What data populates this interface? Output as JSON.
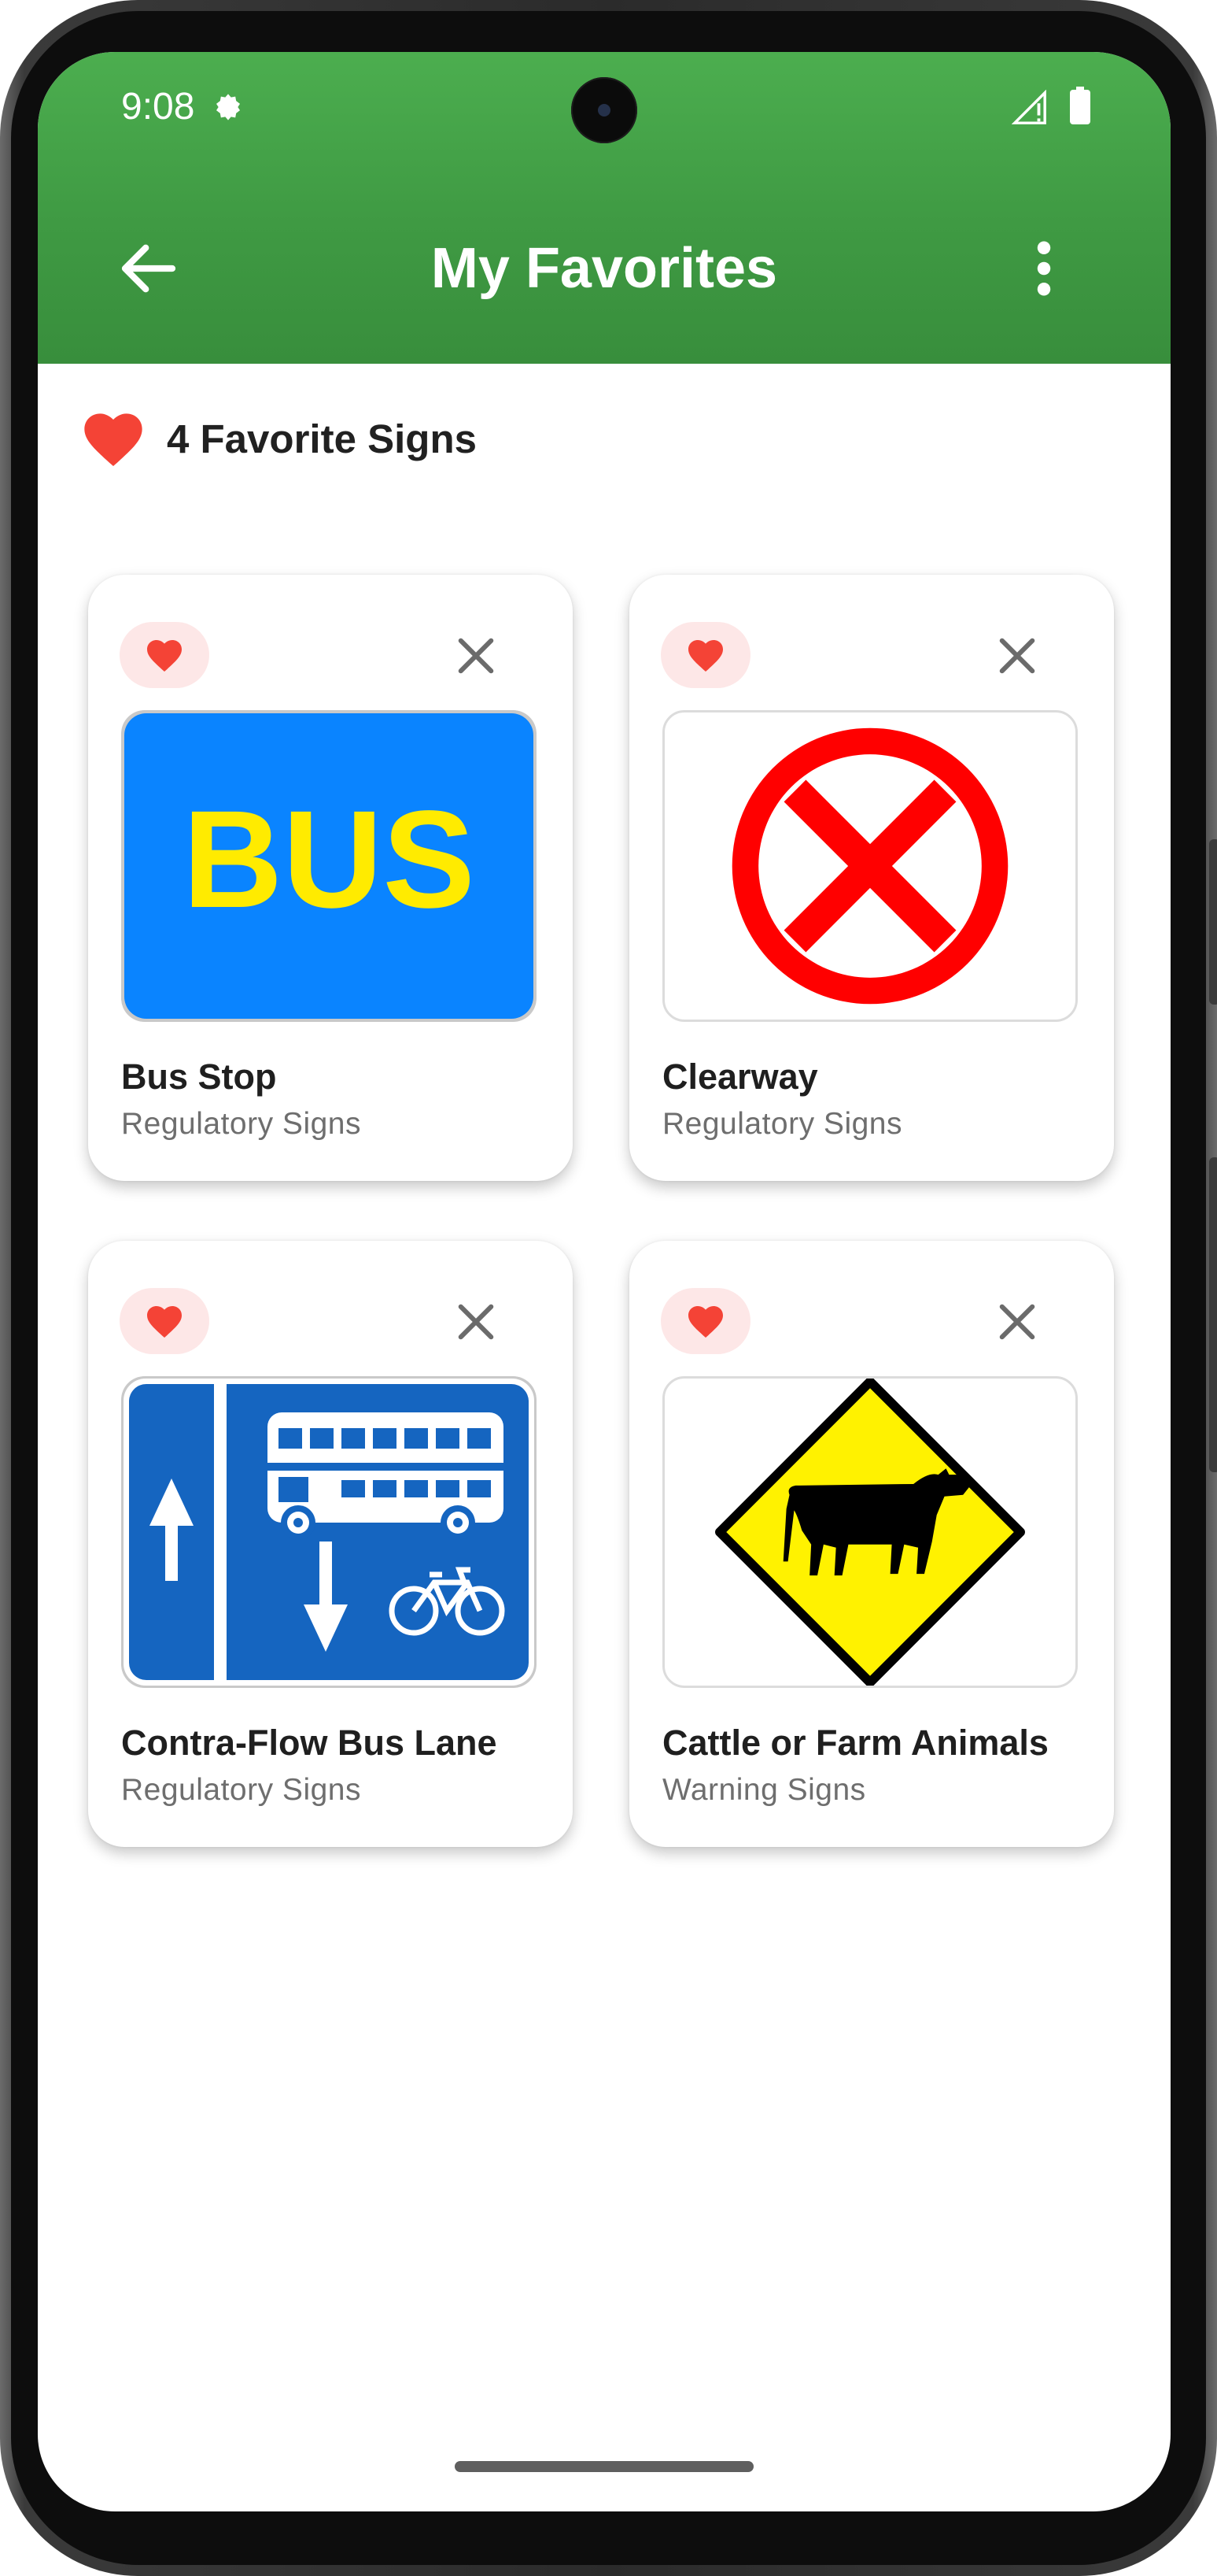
{
  "status_bar": {
    "time": "9:08"
  },
  "app_bar": {
    "title": "My Favorites",
    "back_icon": "arrow-back-icon",
    "menu_icon": "more-vert-icon"
  },
  "favorites_summary": {
    "count_label": "4 Favorite Signs",
    "icon": "heart-icon"
  },
  "cards": [
    {
      "title": "Bus Stop",
      "category": "Regulatory Signs",
      "sign_text": "BUS"
    },
    {
      "title": "Clearway",
      "category": "Regulatory Signs"
    },
    {
      "title": "Contra-Flow Bus Lane",
      "category": "Regulatory Signs"
    },
    {
      "title": "Cattle or Farm Animals",
      "category": "Warning Signs"
    }
  ],
  "colors": {
    "app_bar": "#43a047",
    "heart": "#f44336",
    "fav_pill": "#fde7e7",
    "bus_sign_blue": "#0a84ff",
    "bus_sign_text": "#ffeb00",
    "clearway_red": "#ff0000",
    "bus_lane_blue": "#1565c0",
    "warning_yellow": "#fff200"
  }
}
